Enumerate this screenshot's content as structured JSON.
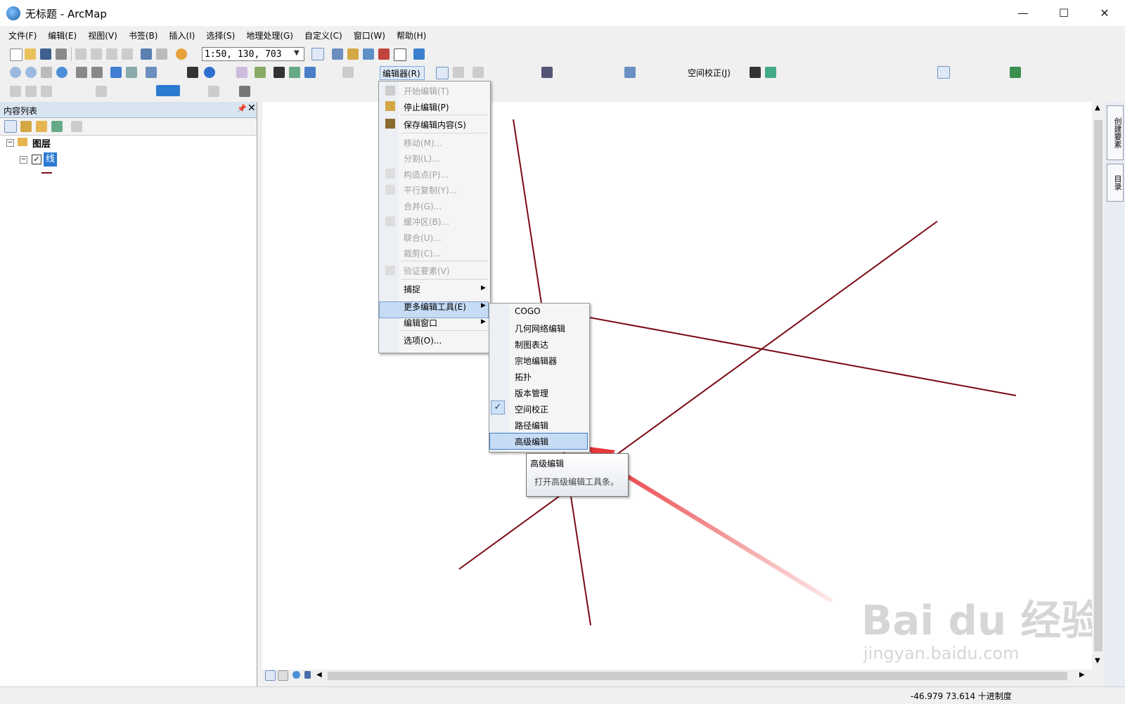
{
  "window": {
    "title": "无标题 - ArcMap",
    "minimize": "—",
    "maximize": "☐",
    "close": "✕"
  },
  "menubar": [
    "文件(F)",
    "编辑(E)",
    "视图(V)",
    "书签(B)",
    "插入(I)",
    "选择(S)",
    "地理处理(G)",
    "自定义(C)",
    "窗口(W)",
    "帮助(H)"
  ],
  "toolbar": {
    "scale": "1:50, 130, 703",
    "editor_label": "编辑器(R)",
    "spatial_adjust_label": "空间校正(J)"
  },
  "toc": {
    "title": "内容列表",
    "root": "图层",
    "layer": "线",
    "pin": "📌",
    "close": "✕"
  },
  "editor_menu": {
    "items": [
      {
        "label": "开始编辑(T)",
        "enabled": false
      },
      {
        "label": "停止编辑(P)",
        "enabled": true
      },
      {
        "label": "保存编辑内容(S)",
        "enabled": true
      },
      {
        "label": "移动(M)...",
        "enabled": false
      },
      {
        "label": "分割(L)...",
        "enabled": false
      },
      {
        "label": "构造点(P)...",
        "enabled": false
      },
      {
        "label": "平行复制(Y)...",
        "enabled": false
      },
      {
        "label": "合并(G)...",
        "enabled": false
      },
      {
        "label": "缓冲区(B)...",
        "enabled": false
      },
      {
        "label": "联合(U)...",
        "enabled": false
      },
      {
        "label": "裁剪(C)...",
        "enabled": false
      },
      {
        "label": "验证要素(V)",
        "enabled": false
      },
      {
        "label": "捕捉",
        "enabled": true
      },
      {
        "label": "更多编辑工具(E)",
        "enabled": true
      },
      {
        "label": "编辑窗口",
        "enabled": true
      },
      {
        "label": "选项(O)...",
        "enabled": true
      }
    ]
  },
  "submenu": {
    "items": [
      "COGO",
      "几何网络编辑",
      "制图表达",
      "宗地编辑器",
      "拓扑",
      "版本管理",
      "空间校正",
      "路径编辑",
      "高级编辑"
    ],
    "checked": "空间校正",
    "highlighted": "高级编辑"
  },
  "tooltip": {
    "title": "高级编辑",
    "description": "打开高级编辑工具条。"
  },
  "side_tabs": [
    "创建要素",
    "目录"
  ],
  "status": {
    "coordinates": "-46.979  73.614 十进制度"
  },
  "watermark": {
    "text": "Bai du 经验",
    "url": "jingyan.baidu.com"
  },
  "colors": {
    "line_feature": "#7a0a14",
    "annotation_arrow": "#e8383d",
    "highlight": "#c6dcf5"
  }
}
